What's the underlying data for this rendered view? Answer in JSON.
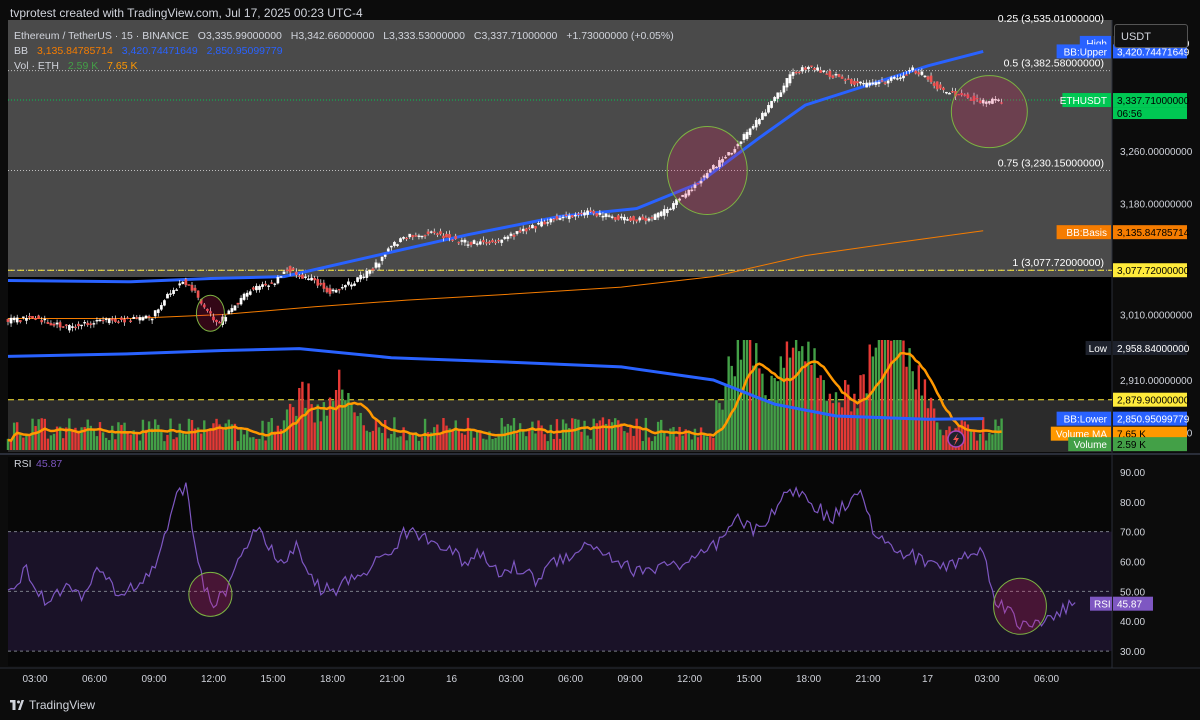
{
  "header": {
    "text": "tvprotest created with TradingView.com, Jul 17, 2025 00:23 UTC-4"
  },
  "legend": {
    "symbol": "Ethereum / TetherUS · 15 · BINANCE",
    "o": "O3,335.99000000",
    "h": "H3,342.66000000",
    "l": "L3,333.53000000",
    "c": "C3,337.71000000",
    "chg": "+1.73000000 (+0.05%)",
    "bb_label": "BB",
    "bb_basis": "3,135.84785714",
    "bb_upper": "3,420.74471649",
    "bb_lower": "2,850.95099779",
    "vol_label": "Vol · ETH",
    "vol_value": "2.59 K",
    "vol_ma": "7.65 K"
  },
  "unit": "USDT",
  "footer": {
    "brand": "TradingView"
  },
  "colors": {
    "bg": "#0c0c0c",
    "pane_dark": "#000000",
    "pane_gray": "#4a4a4a",
    "candle_up": "#26a69a",
    "candle_down": "#ef5350",
    "vol_up": "#43a047",
    "vol_down": "#e53935",
    "bb_band": "#2962ff",
    "bb_basis": "#f57c00",
    "vol_ma": "#ff9800",
    "rsi": "#7e57c2",
    "last_price": "#00c853",
    "fib": "#ffffff"
  },
  "chart_data": [
    {
      "type": "candlestick",
      "symbol": "ETHUSDT",
      "interval": "15",
      "ylim": [
        2800,
        3460
      ],
      "y_ticks": [
        3260,
        3180,
        3010,
        2910,
        2830
      ],
      "y_tick_labels": [
        "3,260.00000000",
        "3,180.00000000",
        "3,010.00000000",
        "2,910.00000000",
        "2,830.00000000"
      ],
      "x_tick_labels": [
        "03:00",
        "06:00",
        "09:00",
        "12:00",
        "15:00",
        "18:00",
        "21:00",
        "16",
        "03:00",
        "06:00",
        "09:00",
        "12:00",
        "15:00",
        "18:00",
        "21:00",
        "17",
        "03:00",
        "06:00"
      ],
      "price_path": [
        [
          0,
          3000
        ],
        [
          10,
          3005
        ],
        [
          20,
          2990
        ],
        [
          30,
          3000
        ],
        [
          40,
          3002
        ],
        [
          48,
          3005
        ],
        [
          52,
          3035
        ],
        [
          58,
          3060
        ],
        [
          62,
          3045
        ],
        [
          66,
          3012
        ],
        [
          70,
          2998
        ],
        [
          74,
          3020
        ],
        [
          80,
          3048
        ],
        [
          88,
          3060
        ],
        [
          92,
          3080
        ],
        [
          96,
          3070
        ],
        [
          100,
          3065
        ],
        [
          106,
          3045
        ],
        [
          114,
          3060
        ],
        [
          120,
          3080
        ],
        [
          126,
          3115
        ],
        [
          132,
          3130
        ],
        [
          140,
          3135
        ],
        [
          150,
          3120
        ],
        [
          160,
          3122
        ],
        [
          170,
          3140
        ],
        [
          180,
          3158
        ],
        [
          190,
          3165
        ],
        [
          200,
          3158
        ],
        [
          210,
          3155
        ],
        [
          216,
          3170
        ],
        [
          222,
          3195
        ],
        [
          230,
          3230
        ],
        [
          238,
          3265
        ],
        [
          246,
          3310
        ],
        [
          252,
          3345
        ],
        [
          256,
          3375
        ],
        [
          262,
          3390
        ],
        [
          270,
          3375
        ],
        [
          280,
          3360
        ],
        [
          290,
          3370
        ],
        [
          296,
          3385
        ],
        [
          300,
          3375
        ],
        [
          306,
          3350
        ],
        [
          312,
          3345
        ],
        [
          318,
          3335
        ],
        [
          324,
          3337
        ]
      ],
      "bb_upper_path": [
        [
          0,
          3062
        ],
        [
          40,
          3060
        ],
        [
          66,
          3065
        ],
        [
          90,
          3068
        ],
        [
          120,
          3100
        ],
        [
          150,
          3132
        ],
        [
          180,
          3160
        ],
        [
          205,
          3172
        ],
        [
          225,
          3210
        ],
        [
          245,
          3280
        ],
        [
          260,
          3330
        ],
        [
          280,
          3360
        ],
        [
          300,
          3390
        ],
        [
          318,
          3412
        ]
      ],
      "bb_basis_path": [
        [
          0,
          3004
        ],
        [
          40,
          3004
        ],
        [
          70,
          3010
        ],
        [
          100,
          3022
        ],
        [
          130,
          3032
        ],
        [
          160,
          3040
        ],
        [
          200,
          3052
        ],
        [
          230,
          3068
        ],
        [
          260,
          3100
        ],
        [
          290,
          3120
        ],
        [
          318,
          3138
        ]
      ],
      "bb_lower_path": [
        [
          0,
          2946
        ],
        [
          40,
          2950
        ],
        [
          70,
          2955
        ],
        [
          95,
          2958
        ],
        [
          125,
          2944
        ],
        [
          160,
          2938
        ],
        [
          200,
          2930
        ],
        [
          230,
          2910
        ],
        [
          250,
          2873
        ],
        [
          270,
          2855
        ],
        [
          300,
          2850
        ],
        [
          318,
          2851
        ]
      ],
      "fib_levels": [
        {
          "label": "0.5 (3,382.58000000)",
          "value": 3382.58
        },
        {
          "label": "0.75 (3,230.15000000)",
          "value": 3230.15
        },
        {
          "label": "1 (3,077.72000000)",
          "value": 3077.72
        }
      ],
      "fib_top_label": "0.25 (3,535.01000000)",
      "price_tags": [
        {
          "label": "High",
          "value_text": "3,425.00000000",
          "value": 3425,
          "label_color": "#2962ff",
          "value_color": "#ffffff",
          "value_bg": "#1e222d"
        },
        {
          "label": "BB:Upper",
          "value_text": "3,420.74471649",
          "value": 3412,
          "label_color": "#2962ff",
          "value_color": "#ffffff",
          "value_bg": "#2962ff"
        },
        {
          "label": "ETHUSDT",
          "value_text": "3,337.71000000",
          "value": 3337.71,
          "label_color": "#00c853",
          "value_color": "#000000",
          "value_bg": "#00c853",
          "extra": "06:56"
        },
        {
          "label": "BB:Basis",
          "value_text": "3,135.84785714",
          "value": 3135.85,
          "label_color": "#f57c00",
          "value_color": "#000000",
          "value_bg": "#f57c00"
        },
        {
          "label": "",
          "value_text": "3,077.72000000",
          "value": 3077.72,
          "label_color": "",
          "value_color": "#000000",
          "value_bg": "#ffeb3b"
        },
        {
          "label": "Low",
          "value_text": "2,958.84000000",
          "value": 2958.84,
          "label_color": "#1e222d",
          "value_color": "#ffffff",
          "value_bg": "#1e222d"
        },
        {
          "label": "",
          "value_text": "2,879.90000000",
          "value": 2879.9,
          "label_color": "",
          "value_color": "#000000",
          "value_bg": "#ffeb3b"
        },
        {
          "label": "BB:Lower",
          "value_text": "2,850.95099779",
          "value": 2850.95,
          "label_color": "#2962ff",
          "value_color": "#ffffff",
          "value_bg": "#2962ff"
        },
        {
          "label": "Volume MA",
          "value_text": "7.65 K",
          "value": 2828,
          "label_color": "#ff9800",
          "value_color": "#000000",
          "value_bg": "#ff9800"
        },
        {
          "label": "Volume",
          "value_text": "2.59 K",
          "value": 2812,
          "label_color": "#43a047",
          "value_color": "#000000",
          "value_bg": "#43a047"
        }
      ],
      "volume_spikes": [
        {
          "x": 240,
          "v": 1.0
        },
        {
          "x": 256,
          "v": 0.78
        },
        {
          "x": 262,
          "v": 0.62
        },
        {
          "x": 285,
          "v": 1.0
        },
        {
          "x": 290,
          "v": 0.85
        },
        {
          "x": 298,
          "v": 0.4
        },
        {
          "x": 96,
          "v": 0.55
        },
        {
          "x": 108,
          "v": 0.52
        }
      ]
    },
    {
      "type": "line",
      "name": "RSI",
      "value_text": "45.87",
      "ylim": [
        25,
        95
      ],
      "y_ticks": [
        90,
        80,
        70,
        60,
        50,
        40,
        30
      ],
      "y_tick_labels": [
        "90.00",
        "80.00",
        "70.00",
        "60.00",
        "50.00",
        "40.00",
        "30.00"
      ],
      "bands": [
        70,
        50,
        30
      ],
      "path": [
        [
          0,
          50
        ],
        [
          6,
          57
        ],
        [
          12,
          46
        ],
        [
          18,
          52
        ],
        [
          24,
          48
        ],
        [
          30,
          57
        ],
        [
          36,
          49
        ],
        [
          42,
          52
        ],
        [
          48,
          58
        ],
        [
          54,
          80
        ],
        [
          58,
          85
        ],
        [
          62,
          60
        ],
        [
          66,
          45
        ],
        [
          70,
          48
        ],
        [
          76,
          63
        ],
        [
          80,
          70
        ],
        [
          84,
          68
        ],
        [
          88,
          58
        ],
        [
          94,
          65
        ],
        [
          100,
          52
        ],
        [
          106,
          50
        ],
        [
          112,
          54
        ],
        [
          118,
          58
        ],
        [
          124,
          63
        ],
        [
          130,
          70
        ],
        [
          136,
          68
        ],
        [
          142,
          66
        ],
        [
          148,
          60
        ],
        [
          154,
          62
        ],
        [
          160,
          56
        ],
        [
          166,
          58
        ],
        [
          172,
          54
        ],
        [
          178,
          60
        ],
        [
          184,
          63
        ],
        [
          190,
          66
        ],
        [
          196,
          62
        ],
        [
          202,
          58
        ],
        [
          208,
          56
        ],
        [
          214,
          60
        ],
        [
          220,
          58
        ],
        [
          226,
          62
        ],
        [
          232,
          66
        ],
        [
          238,
          74
        ],
        [
          244,
          70
        ],
        [
          250,
          78
        ],
        [
          256,
          84
        ],
        [
          262,
          80
        ],
        [
          268,
          74
        ],
        [
          274,
          80
        ],
        [
          278,
          86
        ],
        [
          282,
          70
        ],
        [
          288,
          64
        ],
        [
          294,
          62
        ],
        [
          300,
          60
        ],
        [
          306,
          58
        ],
        [
          312,
          62
        ],
        [
          318,
          63
        ],
        [
          322,
          48
        ],
        [
          326,
          44
        ],
        [
          330,
          38
        ],
        [
          336,
          40
        ],
        [
          342,
          43
        ],
        [
          348,
          45.87
        ]
      ]
    }
  ]
}
